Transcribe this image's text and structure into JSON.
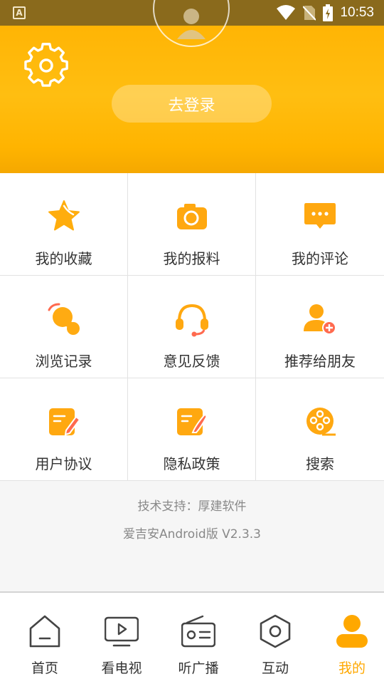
{
  "status_bar": {
    "time": "10:53"
  },
  "header": {
    "login_label": "去登录"
  },
  "menu": [
    {
      "label": "我的收藏",
      "icon": "star-icon"
    },
    {
      "label": "我的报料",
      "icon": "camera-icon"
    },
    {
      "label": "我的评论",
      "icon": "comment-icon"
    },
    {
      "label": "浏览记录",
      "icon": "history-icon"
    },
    {
      "label": "意见反馈",
      "icon": "headset-icon"
    },
    {
      "label": "推荐给朋友",
      "icon": "add-friend-icon"
    },
    {
      "label": "用户协议",
      "icon": "agreement-icon"
    },
    {
      "label": "隐私政策",
      "icon": "privacy-icon"
    },
    {
      "label": "搜索",
      "icon": "film-reel-icon"
    }
  ],
  "footer": {
    "tech_support": "技术支持：厚建软件",
    "version": "爱吉安Android版 V2.3.3"
  },
  "tabs": [
    {
      "label": "首页",
      "icon": "home-icon"
    },
    {
      "label": "看电视",
      "icon": "tv-icon"
    },
    {
      "label": "听广播",
      "icon": "radio-icon"
    },
    {
      "label": "互动",
      "icon": "hexagon-icon"
    },
    {
      "label": "我的",
      "icon": "person-icon",
      "active": true
    }
  ],
  "colors": {
    "accent": "#ffb300",
    "active_tab": "#ffa800",
    "text": "#333333"
  }
}
